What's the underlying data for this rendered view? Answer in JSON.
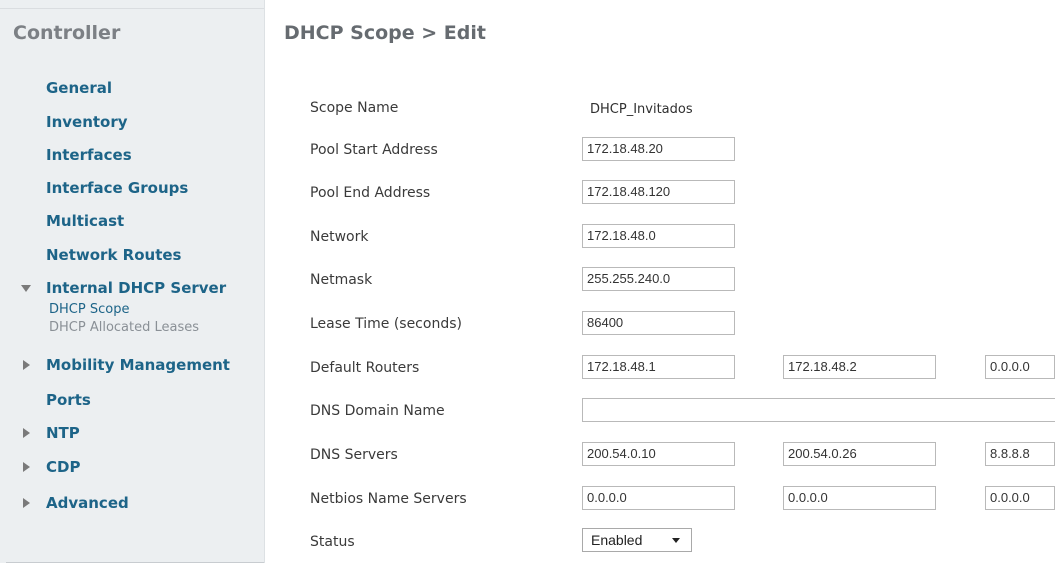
{
  "sidebar": {
    "title": "Controller",
    "items": [
      {
        "label": "General"
      },
      {
        "label": "Inventory"
      },
      {
        "label": "Interfaces"
      },
      {
        "label": "Interface Groups"
      },
      {
        "label": "Multicast"
      },
      {
        "label": "Network Routes"
      },
      {
        "label": "Internal DHCP Server",
        "expanded": true,
        "children": [
          {
            "label": "DHCP Scope",
            "active": true
          },
          {
            "label": "DHCP Allocated Leases"
          }
        ]
      },
      {
        "label": "Mobility Management",
        "expandable": true
      },
      {
        "label": "Ports"
      },
      {
        "label": "NTP",
        "expandable": true
      },
      {
        "label": "CDP",
        "expandable": true
      },
      {
        "label": "Advanced",
        "expandable": true
      }
    ]
  },
  "page": {
    "title": "DHCP Scope > Edit"
  },
  "form": {
    "scope_name": {
      "label": "Scope Name",
      "value": "DHCP_Invitados"
    },
    "pool_start": {
      "label": "Pool Start Address",
      "value": "172.18.48.20"
    },
    "pool_end": {
      "label": "Pool End Address",
      "value": "172.18.48.120"
    },
    "network": {
      "label": "Network",
      "value": "172.18.48.0"
    },
    "netmask": {
      "label": "Netmask",
      "value": "255.255.240.0"
    },
    "lease_time": {
      "label": "Lease Time (seconds)",
      "value": "86400"
    },
    "default_routers": {
      "label": "Default Routers",
      "values": [
        "172.18.48.1",
        "172.18.48.2",
        "0.0.0.0"
      ]
    },
    "dns_domain": {
      "label": "DNS Domain Name",
      "value": ""
    },
    "dns_servers": {
      "label": "DNS Servers",
      "values": [
        "200.54.0.10",
        "200.54.0.26",
        "8.8.8.8"
      ]
    },
    "netbios": {
      "label": "Netbios Name Servers",
      "values": [
        "0.0.0.0",
        "0.0.0.0",
        "0.0.0.0"
      ]
    },
    "status": {
      "label": "Status",
      "value": "Enabled",
      "options_visible": [
        "Enabled"
      ]
    }
  }
}
